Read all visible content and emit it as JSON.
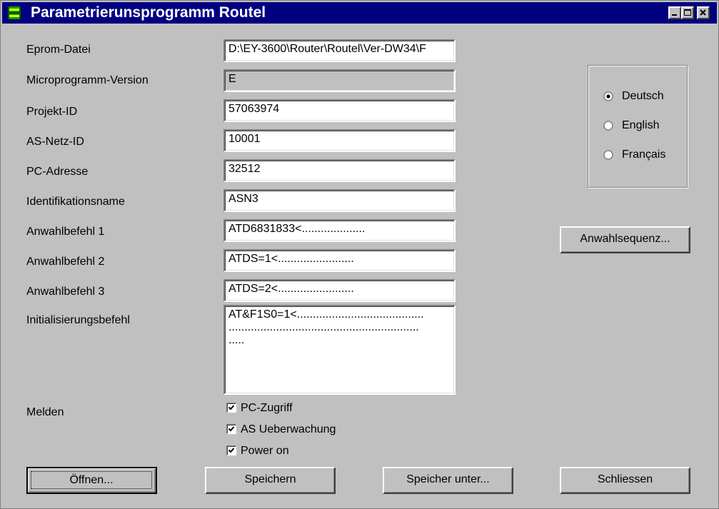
{
  "window": {
    "title": "Parametrierunsprogramm Routel"
  },
  "fields": [
    {
      "label": "Eprom-Datei",
      "value": "D:\\EY-3600\\Router\\Routel\\Ver-DW34\\F"
    },
    {
      "label": "Microprogramm-Version",
      "value": "E"
    },
    {
      "label": "Projekt-ID",
      "value": "57063974"
    },
    {
      "label": "AS-Netz-ID",
      "value": "10001"
    },
    {
      "label": "PC-Adresse",
      "value": "32512"
    },
    {
      "label": "Identifikationsname",
      "value": "ASN3"
    },
    {
      "label": "Anwahlbefehl 1",
      "value": "ATD6831833<...................."
    },
    {
      "label": "Anwahlbefehl 2",
      "value": "ATDS=1<........................"
    },
    {
      "label": "Anwahlbefehl 3",
      "value": "ATDS=2<........................"
    }
  ],
  "init": {
    "label": "Initialisierungsbefehl",
    "lines": [
      "AT&F1S0=1<........................................",
      "............................................................",
      "....."
    ]
  },
  "melden": {
    "label": "Melden",
    "options": [
      {
        "label": "PC-Zugriff",
        "checked": true
      },
      {
        "label": "AS Ueberwachung",
        "checked": true
      },
      {
        "label": "Power on",
        "checked": true
      }
    ]
  },
  "language": {
    "options": [
      {
        "label": "Deutsch",
        "selected": true
      },
      {
        "label": "English",
        "selected": false
      },
      {
        "label": "Français",
        "selected": false
      }
    ]
  },
  "buttons": {
    "anwahlsequenz": "Anwahlsequenz...",
    "oeffnen": "Öffnen...",
    "speichern": "Speichern",
    "speichern_unter": "Speicher unter...",
    "schliessen": "Schliessen"
  },
  "colors": {
    "titlebar": "#000080",
    "face": "#c0c0c0",
    "app_icon": "#00a000"
  },
  "icons": {
    "app": "app-icon",
    "minimize": "minimize-icon",
    "maximize": "maximize-icon",
    "close": "close-icon"
  }
}
